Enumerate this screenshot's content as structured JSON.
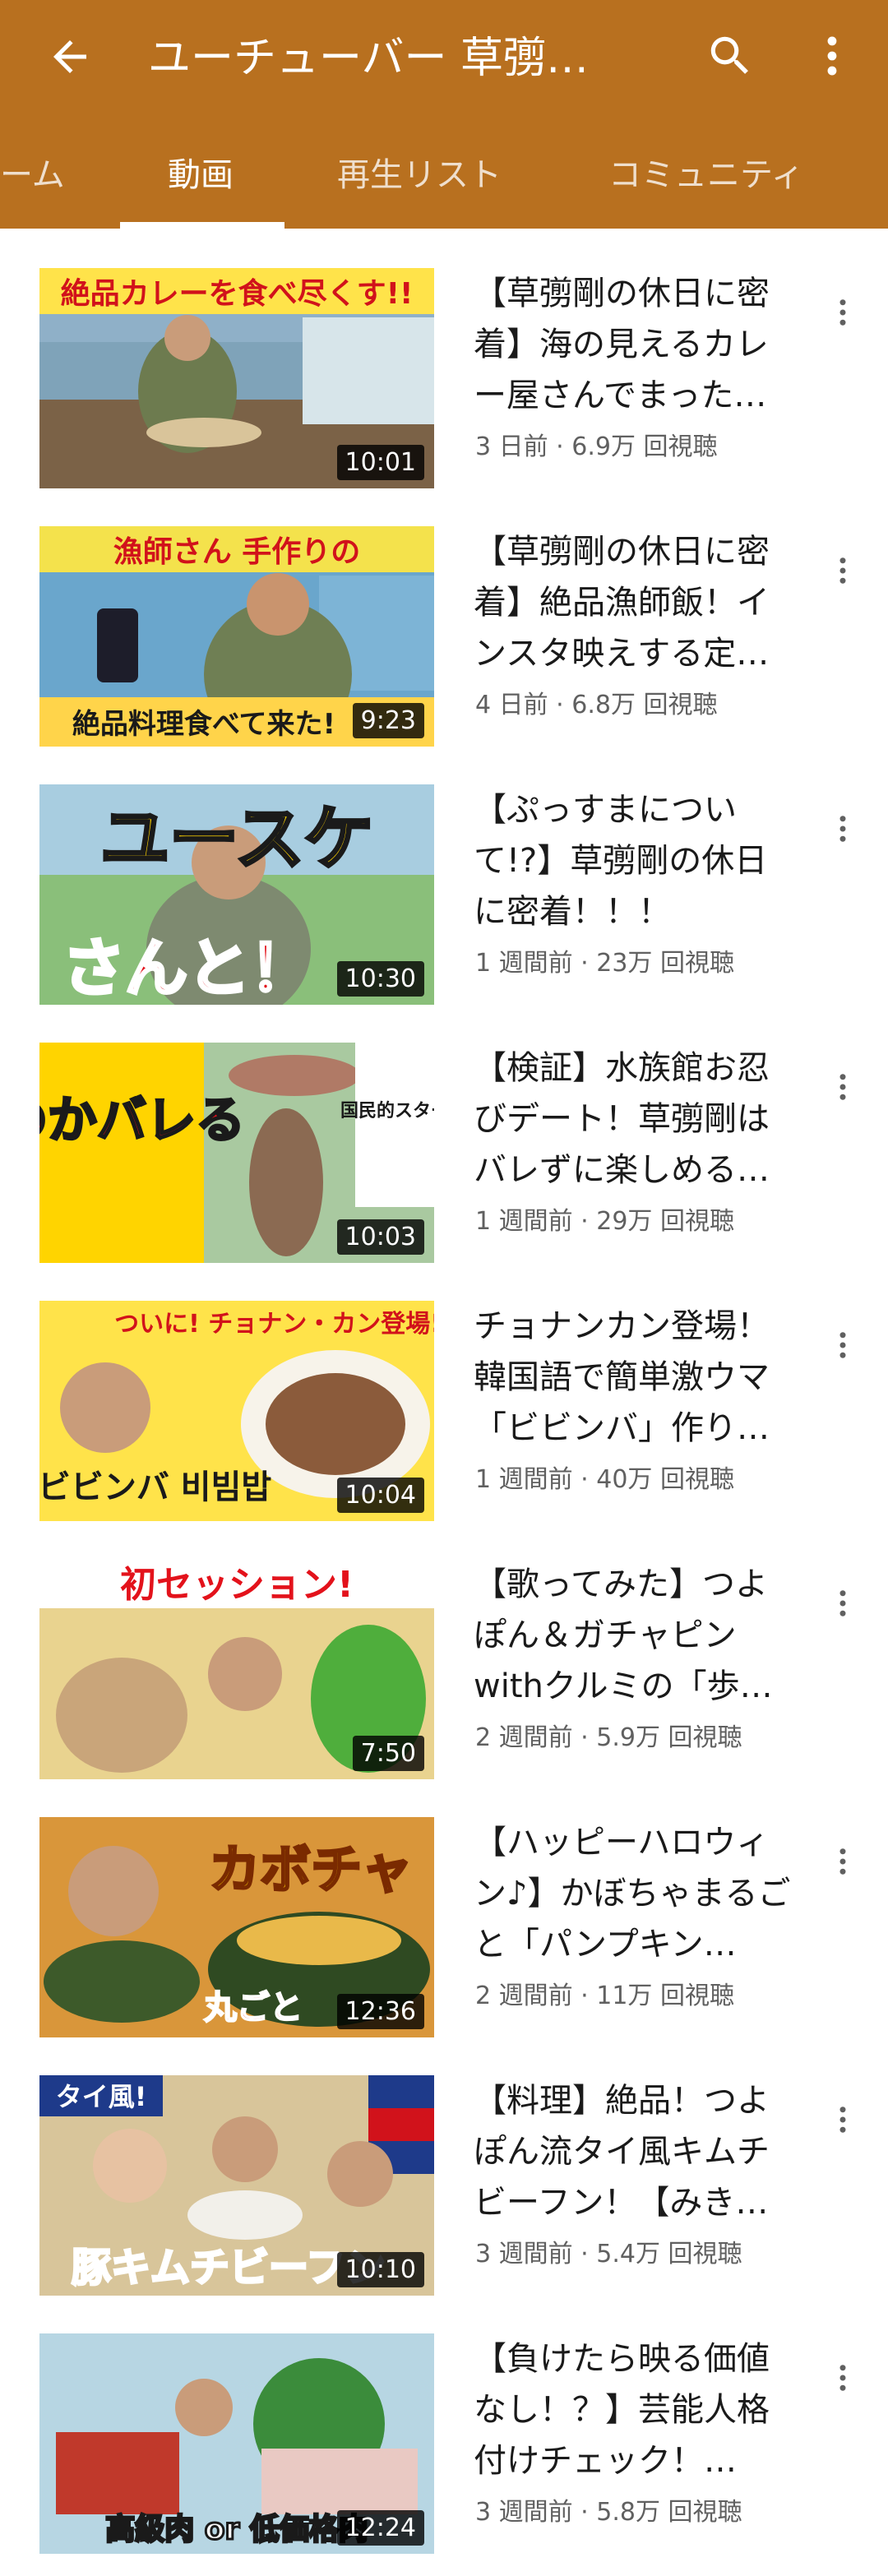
{
  "header": {
    "title": "ユーチューバー 草彅…",
    "background_color": "#b8701f",
    "icons": [
      "back-arrow-icon",
      "search-icon",
      "more-vert-icon"
    ]
  },
  "tabs": [
    {
      "label": "ーム",
      "active": false
    },
    {
      "label": "動画",
      "active": true
    },
    {
      "label": "再生リスト",
      "active": false
    },
    {
      "label": "コミュニティ",
      "active": false
    }
  ],
  "videos": [
    {
      "title": "【草彅剛の休日に密着】海の見えるカレー屋さんでまった…",
      "meta": "3 日前 · 6.9万 回視聴",
      "duration": "10:01",
      "thumb_text": "絶品カレーを食べ尽くす!!"
    },
    {
      "title": "【草彅剛の休日に密着】絶品漁師飯！インスタ映えする定…",
      "meta": "4 日前 · 6.8万 回視聴",
      "duration": "9:23",
      "thumb_text": "漁師さん 手作りの",
      "thumb_text2": "絶品料理食べて来た!"
    },
    {
      "title": "【ぷっすまについて!?】草彅剛の休日に密着！！！",
      "meta": "1 週間前 · 23万 回視聴",
      "duration": "10:30",
      "thumb_text": "ユースケ",
      "thumb_text2": "さんと！"
    },
    {
      "title": "【検証】水族館お忍びデート！草彅剛はバレずに楽しめる…",
      "meta": "1 週間前 · 29万 回視聴",
      "duration": "10:03",
      "thumb_text": "のかバレる",
      "thumb_text2": "国民的スター"
    },
    {
      "title": "チョナンカン登場！韓国語で簡単激ウマ「ビビンバ」作り…",
      "meta": "1 週間前 · 40万 回視聴",
      "duration": "10:04",
      "thumb_text": "ついに! チョナン・カン登場!",
      "thumb_text2": "ビビンバ 비빔밥"
    },
    {
      "title": "【歌ってみた】つよぽん＆ガチャピンwithクルミの「歩…",
      "meta": "2 週間前 · 5.9万 回視聴",
      "duration": "7:50",
      "thumb_text": "初セッション!"
    },
    {
      "title": "【ハッピーハロウィン♪】かぼちゃまるごと「パンプキン…",
      "meta": "2 週間前 · 11万 回視聴",
      "duration": "12:36",
      "thumb_text": "カボチャ",
      "thumb_text2": "丸ごと"
    },
    {
      "title": "【料理】絶品！つよぽん流タイ風キムチビーフン！【みき…",
      "meta": "3 週間前 · 5.4万 回視聴",
      "duration": "10:10",
      "thumb_text": "タイ風!",
      "thumb_text2": "豚キムチビーフン"
    },
    {
      "title": "【負けたら映る価値なし！？】芸能人格付けチェック！…",
      "meta": "3 週間前 · 5.8万 回視聴",
      "duration": "12:24",
      "thumb_text": "高級肉 or 低価格肉"
    }
  ]
}
